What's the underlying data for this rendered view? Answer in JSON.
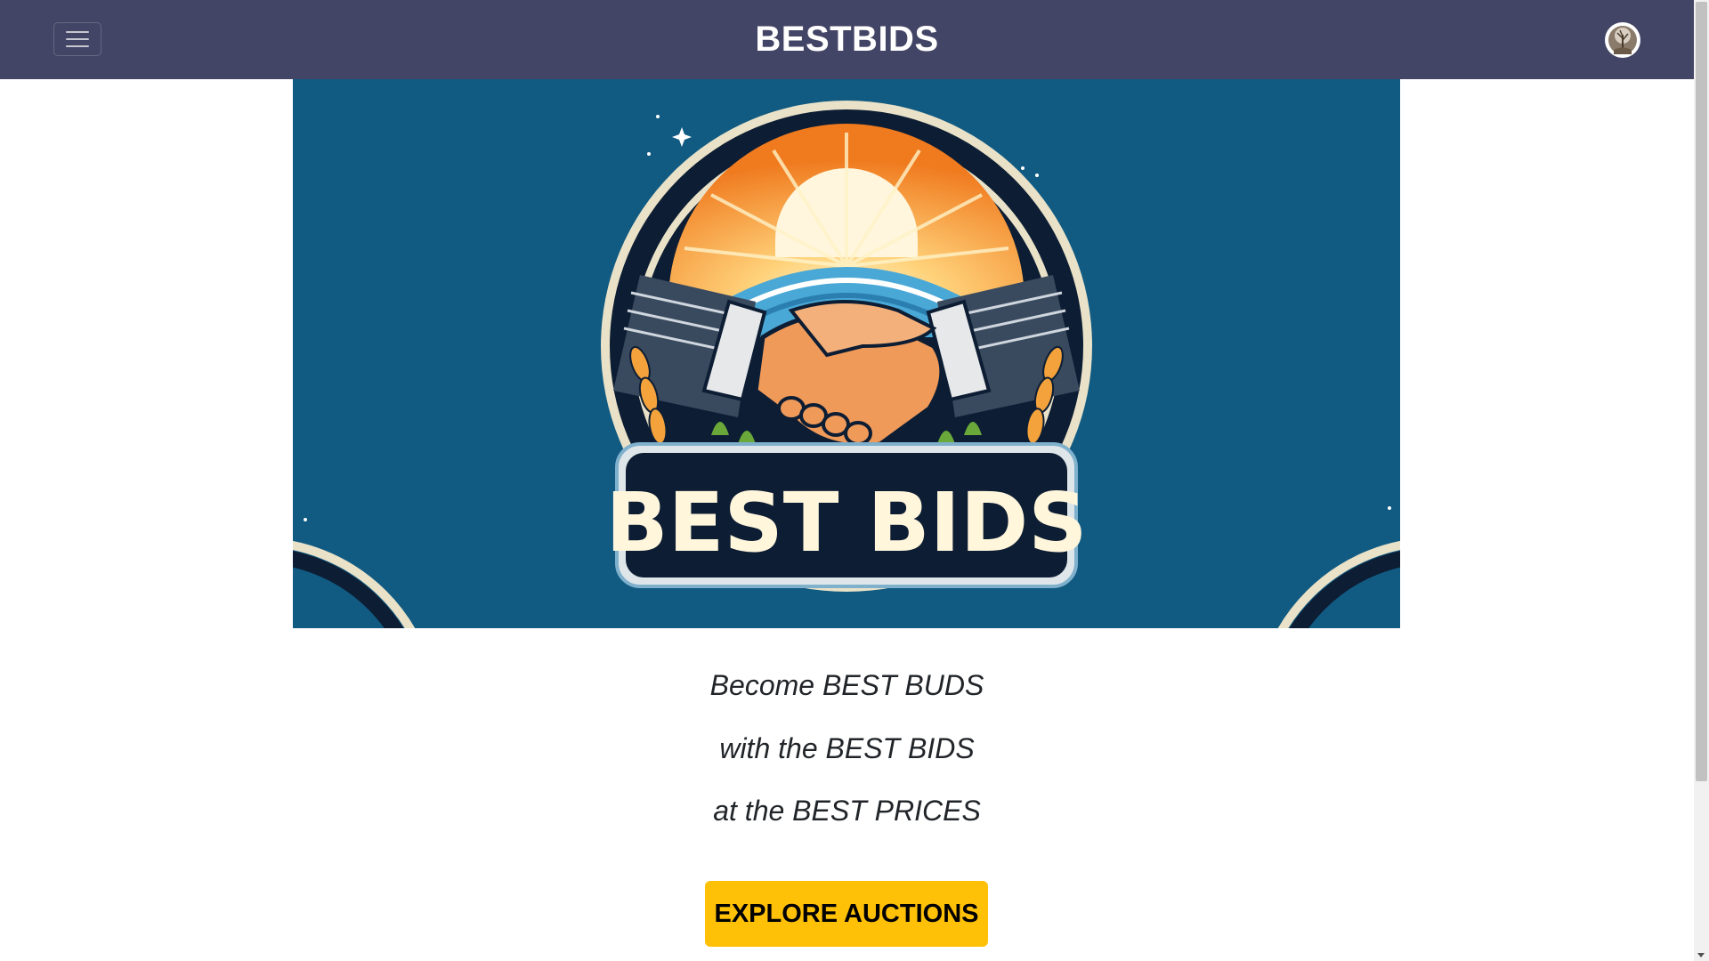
{
  "navbar": {
    "brand": "BESTBIDS",
    "menu_icon": "hamburger-menu-icon",
    "avatar_icon": "user-avatar-icon",
    "background": "#434566"
  },
  "hero": {
    "logo_text": "BEST BIDS",
    "background": "#115a82"
  },
  "taglines": [
    "Become BEST BUDS",
    "with the BEST BIDS",
    "at the BEST PRICES"
  ],
  "cta": {
    "label": "EXPLORE AUCTIONS",
    "color": "#ffc107"
  }
}
